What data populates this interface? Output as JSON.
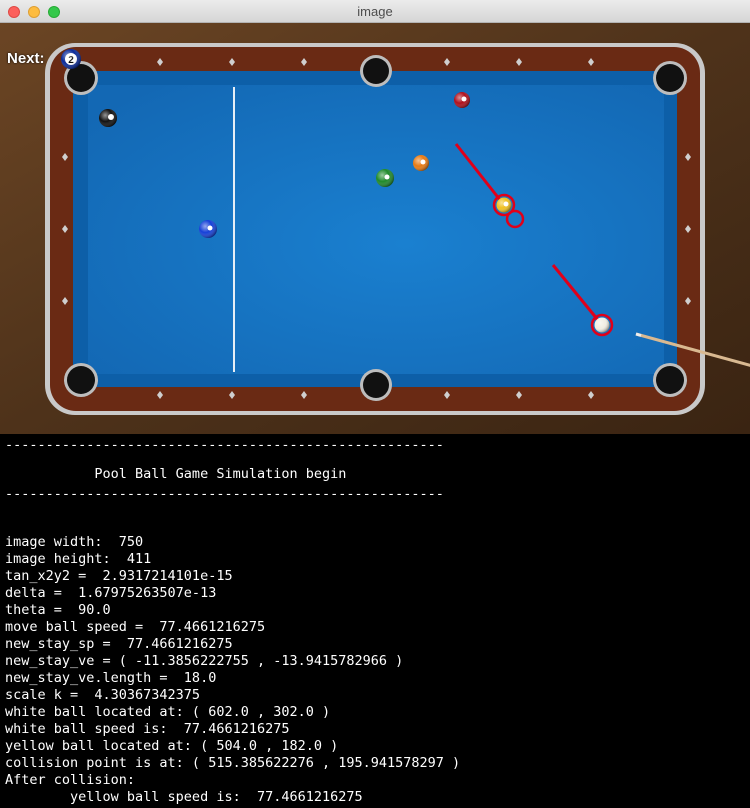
{
  "window": {
    "title": "image"
  },
  "game": {
    "next_label": "Next:",
    "next_ball_number": "2"
  },
  "console": {
    "lines": [
      "------------------------------------------------------",
      "",
      "           Pool Ball Game Simulation begin",
      "",
      "------------------------------------------------------",
      "",
      "",
      "",
      "image width:  750",
      "image height:  411",
      "tan_x2y2 =  2.9317214101e-15",
      "delta =  1.67975263507e-13",
      "theta =  90.0",
      "move ball speed =  77.4661216275",
      "new_stay_sp =  77.4661216275",
      "new_stay_ve = ( -11.3856222755 , -13.9415782966 )",
      "new_stay_ve.length =  18.0",
      "scale k =  4.30367342375",
      "white ball located at: ( 602.0 , 302.0 )",
      "white ball speed is:  77.4661216275",
      "yellow ball located at: ( 504.0 , 182.0 )",
      "collision point is at: ( 515.385622276 , 195.941578297 )",
      "After collision:",
      "        yellow ball speed is:  77.4661216275"
    ]
  },
  "colors": {
    "felt": "#1574c4",
    "rail": "#6a2a14",
    "wood": "#5a3a1e",
    "trajectory": "#e0001a"
  }
}
